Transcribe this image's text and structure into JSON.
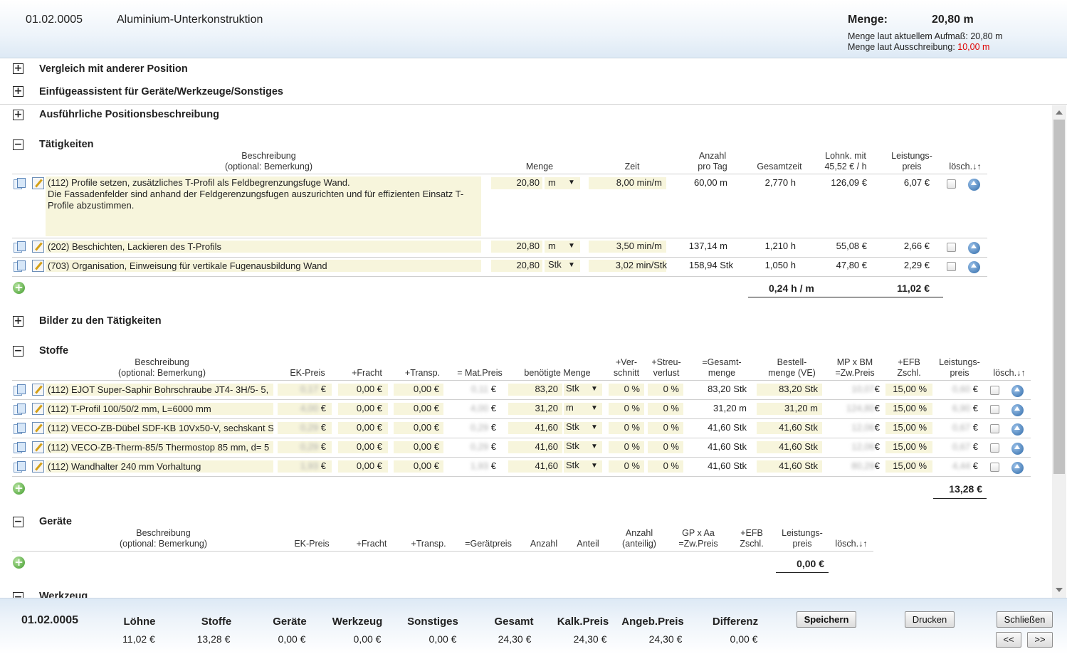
{
  "header": {
    "code": "01.02.0005",
    "title": "Aluminium-Unterkonstruktion",
    "menge_label": "Menge:",
    "menge_value": "20,80 m",
    "aufmass_label": "Menge laut aktuellem Aufmaß: ",
    "aufmass_value": "20,80 m",
    "ausschreibung_label": "Menge laut Ausschreibung: ",
    "ausschreibung_value": "10,00 m"
  },
  "sections": {
    "vergleich": {
      "toggle": "+",
      "title": "Vergleich mit anderer Position"
    },
    "einfuege": {
      "toggle": "+",
      "title": "Einfügeassistent für Geräte/Werkzeuge/Sonstiges"
    },
    "ausfuehrlich": {
      "toggle": "+",
      "title": "Ausführliche Positionsbeschreibung"
    },
    "taetigkeiten": {
      "toggle": "−",
      "title": "Tätigkeiten"
    },
    "bilder": {
      "toggle": "+",
      "title": "Bilder zu den Tätigkeiten"
    },
    "stoffe": {
      "toggle": "−",
      "title": "Stoffe"
    },
    "geraete": {
      "toggle": "−",
      "title": "Geräte"
    },
    "werkzeug": {
      "toggle": "−",
      "title": "Werkzeug"
    }
  },
  "taetigkeiten": {
    "headers": {
      "beschreibung": "Beschreibung",
      "beschreibung_sub": "(optional: Bemerkung)",
      "menge": "Menge",
      "zeit": "Zeit",
      "anzahl": "Anzahl",
      "anzahl_sub": "pro Tag",
      "gesamtzeit": "Gesamtzeit",
      "lohnk": "Lohnk. mit",
      "lohnk_sub": "45,52 € / h",
      "leistung": "Leistungs-",
      "leistung_sub": "preis",
      "loesch": "lösch.↓↑"
    },
    "rows": [
      {
        "desc": "(112) Profile setzen, zusätzliches T-Profil als Feldbegrenzungsfuge Wand.\nDie Fassadenfelder sind anhand der Feldgerenzungsfugen auszurichten und für effizienten Einsatz T-Profile abzustimmen.",
        "menge": "20,80",
        "unit": "m",
        "zeit": "8,00 min/m",
        "anzahl": "60,00 m",
        "gesamtzeit": "2,770 h",
        "lohnk": "126,09 €",
        "preis": "6,07 €"
      },
      {
        "desc": "(202) Beschichten, Lackieren des T-Profils",
        "menge": "20,80",
        "unit": "m",
        "zeit": "3,50 min/m",
        "anzahl": "137,14 m",
        "gesamtzeit": "1,210 h",
        "lohnk": "55,08 €",
        "preis": "2,66 €"
      },
      {
        "desc": "(703) Organisation, Einweisung für vertikale Fugenausbildung Wand",
        "menge": "20,80",
        "unit": "Stk",
        "zeit": "3,02 min/Stk",
        "anzahl": "158,94 Stk",
        "gesamtzeit": "1,050 h",
        "lohnk": "47,80 €",
        "preis": "2,29 €"
      }
    ],
    "total_time": "0,24 h / m",
    "total_price": "11,02 €"
  },
  "stoffe": {
    "headers": {
      "beschreibung": "Beschreibung",
      "beschreibung_sub": "(optional: Bemerkung)",
      "ek": "EK-Preis",
      "fracht": "+Fracht",
      "transp": "+Transp.",
      "matpreis": "= Mat.Preis",
      "benoetigt": "benötigte Menge",
      "verschnitt": "+Ver-",
      "verschnitt_sub": "schnitt",
      "streu": "+Streu-",
      "streu_sub": "verlust",
      "gesamt": "=Gesamt-",
      "gesamt_sub": "menge",
      "bestell": "Bestell-",
      "bestell_sub": "menge (VE)",
      "mp": "MP x BM",
      "mp_sub": "=Zw.Preis",
      "efb": "+EFB",
      "efb_sub": "Zschl.",
      "leistung": "Leistungs-",
      "leistung_sub": "preis",
      "loesch": "lösch.↓↑"
    },
    "rows": [
      {
        "desc": "(112) EJOT Super-Saphir Bohrschraube JT4- 3H/5- 5,",
        "ek": "0,17",
        "fracht": "0,00 €",
        "transp": "0,00 €",
        "mat": "0,11",
        "menge": "83,20",
        "unit": "Stk",
        "verschnitt": "0 %",
        "streu": "0 %",
        "gesamt": "83,20 Stk",
        "bestell": "83,20 Stk",
        "mp": "10,07",
        "efb": "15,00 %",
        "preis": "0,60"
      },
      {
        "desc": "(112) T-Profil 100/50/2 mm, L=6000 mm",
        "ek": "4,00",
        "fracht": "0,00 €",
        "transp": "0,00 €",
        "mat": "4,00",
        "menge": "31,20",
        "unit": "m",
        "verschnitt": "0 %",
        "streu": "0 %",
        "gesamt": "31,20 m",
        "bestell": "31,20 m",
        "mp": "124,80",
        "efb": "15,00 %",
        "preis": "6,90"
      },
      {
        "desc": "(112) VECO-ZB-Dübel SDF-KB 10Vx50-V, sechskant S",
        "ek": "0,29",
        "fracht": "0,00 €",
        "transp": "0,00 €",
        "mat": "0,29",
        "menge": "41,60",
        "unit": "Stk",
        "verschnitt": "0 %",
        "streu": "0 %",
        "gesamt": "41,60 Stk",
        "bestell": "41,60 Stk",
        "mp": "12,06",
        "efb": "15,00 %",
        "preis": "0,67"
      },
      {
        "desc": "(112) VECO-ZB-Therm-85/5 Thermostop 85 mm, d= 5",
        "ek": "0,29",
        "fracht": "0,00 €",
        "transp": "0,00 €",
        "mat": "0,29",
        "menge": "41,60",
        "unit": "Stk",
        "verschnitt": "0 %",
        "streu": "0 %",
        "gesamt": "41,60 Stk",
        "bestell": "41,60 Stk",
        "mp": "12,06",
        "efb": "15,00 %",
        "preis": "0,67"
      },
      {
        "desc": "(112) Wandhalter 240 mm Vorhaltung",
        "ek": "1,93",
        "fracht": "0,00 €",
        "transp": "0,00 €",
        "mat": "1,93",
        "menge": "41,60",
        "unit": "Stk",
        "verschnitt": "0 %",
        "streu": "0 %",
        "gesamt": "41,60 Stk",
        "bestell": "41,60 Stk",
        "mp": "80,29",
        "efb": "15,00 %",
        "preis": "4,44"
      }
    ],
    "total_price": "13,28 €"
  },
  "geraete": {
    "headers": {
      "beschreibung": "Beschreibung",
      "beschreibung_sub": "(optional: Bemerkung)",
      "ek": "EK-Preis",
      "fracht": "+Fracht",
      "transp": "+Transp.",
      "geraetpreis": "=Gerätpreis",
      "anzahl": "Anzahl",
      "anteil": "Anteil",
      "anzahl2": "Anzahl",
      "anzahl2_sub": "(anteilig)",
      "gp": "GP x Aa",
      "gp_sub": "=Zw.Preis",
      "efb": "+EFB",
      "efb_sub": "Zschl.",
      "leistung": "Leistungs-",
      "leistung_sub": "preis",
      "loesch": "lösch.↓↑"
    },
    "total_price": "0,00 €"
  },
  "footer": {
    "code": "01.02.0005",
    "labels": {
      "loehne": "Löhne",
      "stoffe": "Stoffe",
      "geraete": "Geräte",
      "werkzeug": "Werkzeug",
      "sonstiges": "Sonstiges",
      "gesamt": "Gesamt",
      "kalk": "Kalk.Preis",
      "angeb": "Angeb.Preis",
      "differenz": "Differenz"
    },
    "values": {
      "loehne": "11,02 €",
      "stoffe": "13,28 €",
      "geraete": "0,00 €",
      "werkzeug": "0,00 €",
      "sonstiges": "0,00 €",
      "gesamt": "24,30 €",
      "kalk": "24,30 €",
      "angeb": "24,30 €",
      "differenz": "0,00 €"
    },
    "buttons": {
      "speichern": "Speichern",
      "drucken": "Drucken",
      "schliessen": "Schließen",
      "prev": "<<",
      "next": ">>"
    }
  }
}
